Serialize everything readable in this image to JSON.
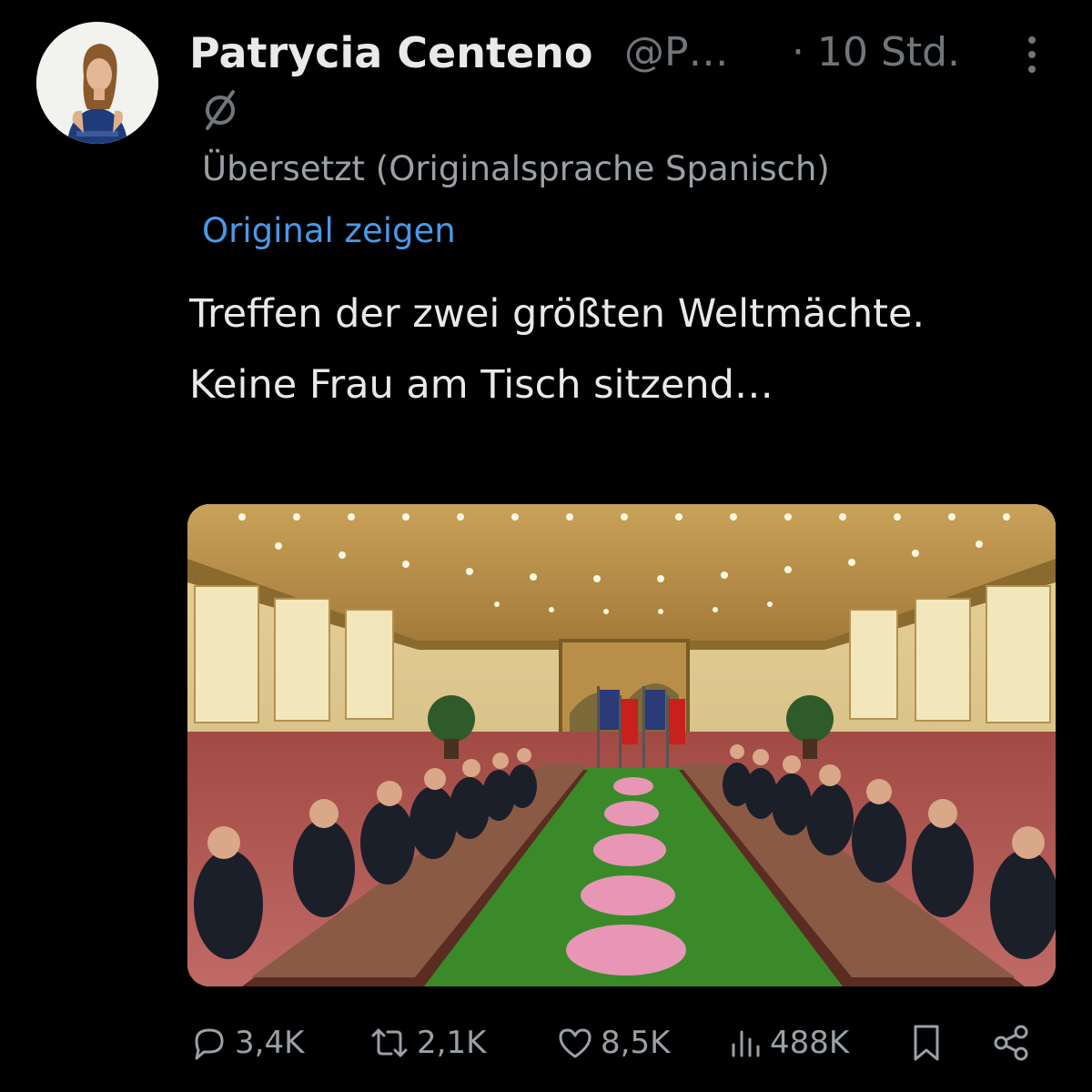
{
  "tweet": {
    "author": {
      "display_name": "Patrycia Centeno",
      "handle": "@P…",
      "avatar_icon": "user-photo"
    },
    "time": "· 10 Std.",
    "badge_icon": "empty-set-badge",
    "translation_note": "Übersetzt (Originalsprache Spanisch)",
    "show_original_label": "Original zeigen",
    "text": "Treffen der zwei größten Weltmächte. Keine Frau am Tisch sitzend…",
    "media": {
      "kind": "photo"
    },
    "actions": {
      "replies": "3,4K",
      "reposts": "2,1K",
      "likes": "8,5K",
      "views": "488K"
    }
  },
  "colors": {
    "background": "#000000",
    "primary_text": "#e7e9ea",
    "secondary_text": "#71767b",
    "link": "#4a99e9"
  }
}
